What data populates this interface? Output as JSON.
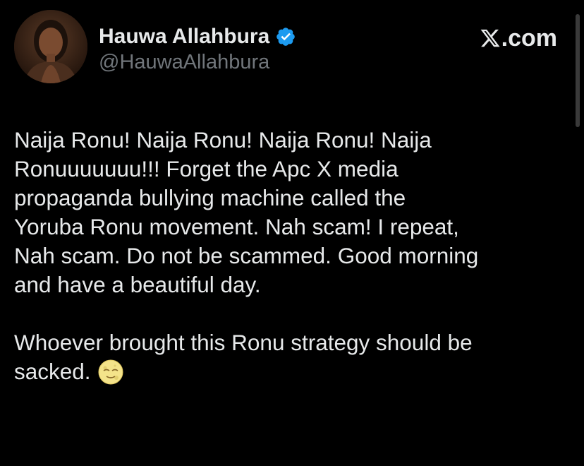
{
  "author": {
    "display_name": "Hauwa Allahbura",
    "handle": "@HauwaAllahbura",
    "verified": true,
    "avatar_icon": "profile-photo"
  },
  "brand": {
    "text": ".com",
    "logo_icon": "x-logo-icon"
  },
  "tweet": {
    "paragraph1_lines": [
      "Naija Ronu! Naija Ronu! Naija Ronu! Naija",
      "Ronuuuuuuu!!! Forget the Apc X media",
      "propaganda bullying machine called the",
      "Yoruba Ronu movement. Nah scam! I repeat,",
      "Nah scam. Do not be scammed. Good morning",
      "and have a beautiful day."
    ],
    "paragraph2_lines": [
      "Whoever brought this Ronu strategy should be",
      "sacked."
    ],
    "emoji_icon": "new-moon-face-emoji"
  },
  "colors": {
    "background": "#000000",
    "text_primary": "#e7e9ea",
    "text_secondary": "#71767b",
    "verified_blue": "#1d9bf0"
  }
}
